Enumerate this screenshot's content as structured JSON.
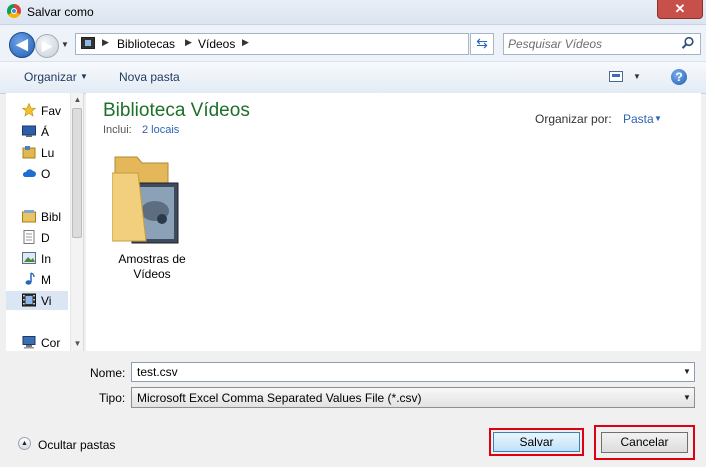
{
  "window": {
    "title": "Salvar como",
    "close_glyph": "✕"
  },
  "nav": {
    "breadcrumb": [
      "Bibliotecas",
      "Vídeos"
    ],
    "search_placeholder": "Pesquisar Vídeos"
  },
  "toolbar": {
    "organize": "Organizar",
    "new_folder": "Nova pasta",
    "help": "?"
  },
  "sidebar": {
    "items": [
      {
        "label": "Fav",
        "icon": "star-icon"
      },
      {
        "label": "Á",
        "icon": "desktop-icon"
      },
      {
        "label": "Lu",
        "icon": "places-icon"
      },
      {
        "label": "O",
        "icon": "cloud-icon"
      },
      {
        "label": "Bibl",
        "icon": "libraries-icon"
      },
      {
        "label": "D",
        "icon": "document-icon"
      },
      {
        "label": "In",
        "icon": "image-icon"
      },
      {
        "label": "M",
        "icon": "music-icon"
      },
      {
        "label": "Vi",
        "icon": "video-icon",
        "selected": true
      },
      {
        "label": "Cor",
        "icon": "computer-icon"
      }
    ]
  },
  "content": {
    "library_title": "Biblioteca Vídeos",
    "include_label": "Inclui:",
    "include_link": "2 locais",
    "arrange_label": "Organizar por:",
    "arrange_value": "Pasta",
    "folder": {
      "label_line1": "Amostras de",
      "label_line2": "Vídeos"
    }
  },
  "form": {
    "name_label": "Nome:",
    "name_value": "test.csv",
    "type_label": "Tipo:",
    "type_value": "Microsoft Excel Comma Separated Values File (*.csv)"
  },
  "footer": {
    "hide_folders": "Ocultar pastas",
    "save": "Salvar",
    "cancel": "Cancelar"
  },
  "colors": {
    "highlight_border": "#e00012",
    "library_title": "#1e6f28",
    "link": "#2d63b5"
  }
}
